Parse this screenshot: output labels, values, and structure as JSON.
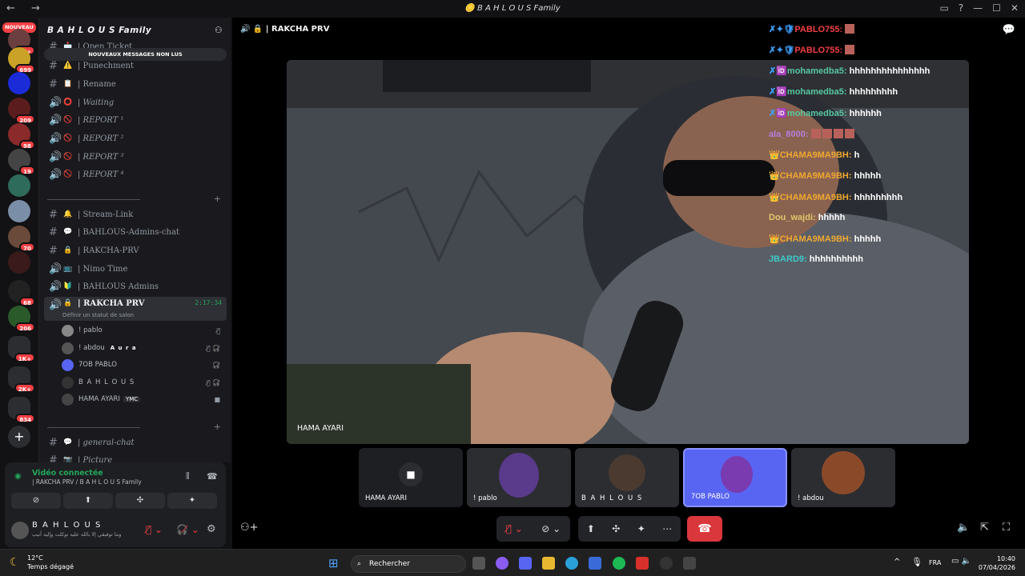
{
  "window": {
    "title": "🪙 B A H L O U S Family"
  },
  "rail": {
    "new_badge": "NOUVEAU",
    "badges": [
      "1K+",
      "699",
      "209",
      "98",
      "19",
      "70",
      "68",
      "206",
      "1K+",
      "2K+",
      "834"
    ]
  },
  "server": {
    "name": "B A H L O U S Family",
    "unread_banner": "NOUVEAUX MESSAGES NON LUS",
    "channels": [
      {
        "label": "| Open Ticket",
        "emoji": "📩"
      },
      {
        "label": "| Punechment",
        "emoji": "⚠️"
      },
      {
        "label": "| Rename",
        "emoji": "📋"
      },
      {
        "label": "| Waiting",
        "emoji": "⭕"
      },
      {
        "label": "| REPORT ¹",
        "emoji": "🚫"
      },
      {
        "label": "| REPORT ²",
        "emoji": "🚫"
      },
      {
        "label": "| REPORT ³",
        "emoji": "🚫"
      },
      {
        "label": "| REPORT ⁴",
        "emoji": "🚫"
      },
      {
        "label": "| Stream-Link",
        "emoji": "🔔"
      },
      {
        "label": "| BAHLOUS-Admins-chat",
        "emoji": "💬"
      },
      {
        "label": "| RAKCHA-PRV",
        "emoji": "🔒"
      },
      {
        "label": "| Nimo Time",
        "emoji": "📺"
      },
      {
        "label": "| BAHLOUS Admins",
        "emoji": "🔰"
      },
      {
        "label": "| RAKCHA PRV",
        "emoji": "🔒",
        "time": "2:17:34"
      },
      {
        "label": "| general-chat",
        "emoji": "💬"
      },
      {
        "label": "| Picture",
        "emoji": "📷"
      }
    ],
    "status_hint": "Définir un statut de salon",
    "members": [
      {
        "name": "! pablo",
        "tag": ""
      },
      {
        "name": "! abdou",
        "tag": "A u r a"
      },
      {
        "name": "7OB PABLO",
        "tag": ""
      },
      {
        "name": "B A H L O U S",
        "tag": ""
      },
      {
        "name": "HAMA AYARI",
        "tag": "YMC"
      }
    ]
  },
  "voice": {
    "status": "Vidéo connectée",
    "channel": "| RAKCHA PRV / B A H L O U S Family",
    "user_name": "B A H L O U S",
    "user_status": "وما توفيقي إلا بالله عليه توكلت وإليه أنيب"
  },
  "main": {
    "channel_title": "| RAKCHA PRV",
    "video_label": "HAMA AYARI",
    "tiles": [
      "HAMA AYARI",
      "! pablo",
      "B A H L O U S",
      "7OB PABLO",
      "! abdou"
    ]
  },
  "chat": [
    {
      "user": "PABLO755:",
      "msg": "",
      "color": "#f23f43",
      "prefix": "✗✦🛡"
    },
    {
      "user": "PABLO755:",
      "msg": "",
      "color": "#f23f43",
      "prefix": "✗✦🛡"
    },
    {
      "user": "mohamedba5:",
      "msg": "hhhhhhhhhhhhhhh",
      "color": "#57c7a0",
      "prefix": "✗🆔"
    },
    {
      "user": "mohamedba5:",
      "msg": "hhhhhhhhh",
      "color": "#57c7a0",
      "prefix": "✗🆔"
    },
    {
      "user": "mohamedba5:",
      "msg": "hhhhhh",
      "color": "#57c7a0",
      "prefix": "✗🆔"
    },
    {
      "user": "ala_8000:",
      "msg": "",
      "color": "#b57edc",
      "prefix": ""
    },
    {
      "user": "CHAMA9MA9BH:",
      "msg": "h",
      "color": "#f0a830",
      "prefix": "👑"
    },
    {
      "user": "CHAMA9MA9BH:",
      "msg": "hhhhh",
      "color": "#f0a830",
      "prefix": "👑"
    },
    {
      "user": "CHAMA9MA9BH:",
      "msg": "hhhhhhhhh",
      "color": "#f0a830",
      "prefix": "👑"
    },
    {
      "user": "Dou_wajdi:",
      "msg": "hhhhh",
      "color": "#e0c66b",
      "prefix": ""
    },
    {
      "user": "CHAMA9MA9BH:",
      "msg": "hhhhh",
      "color": "#f0a830",
      "prefix": "👑"
    },
    {
      "user": "JBARD9:",
      "msg": "hhhhhhhhhh",
      "color": "#3ec9c9",
      "prefix": ""
    }
  ],
  "taskbar": {
    "temp": "12°C",
    "weather": "Temps dégagé",
    "search_placeholder": "Rechercher",
    "lang": "FRA",
    "time": "10:40",
    "date": "07/04/2026"
  }
}
